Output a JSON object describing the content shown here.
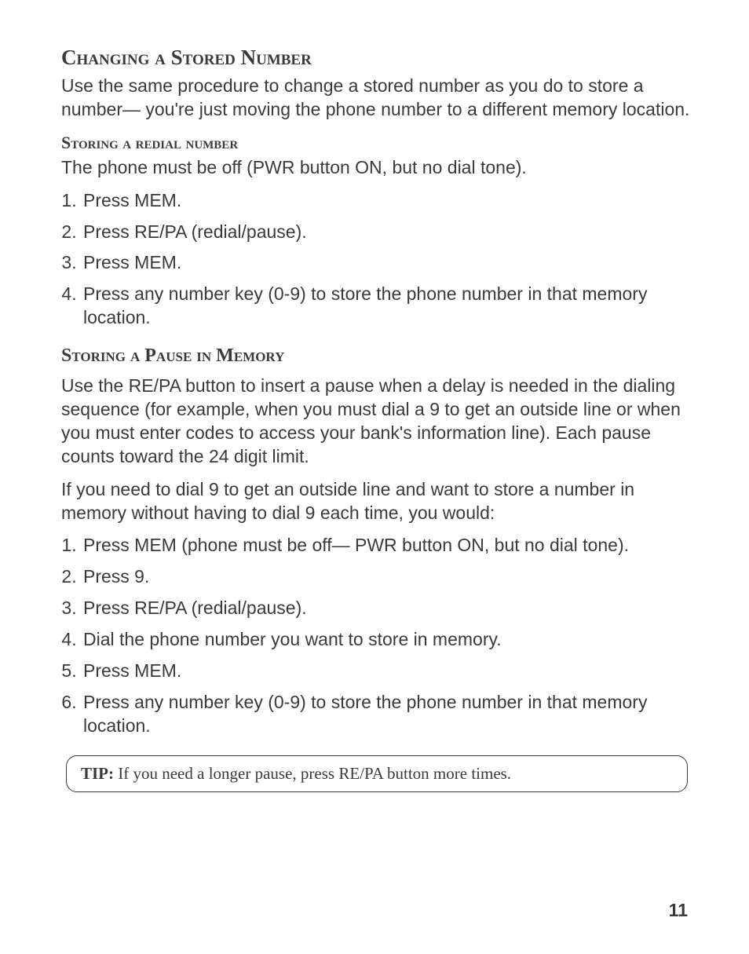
{
  "section1": {
    "heading": "Changing a Stored Number",
    "body": "Use the same procedure to change a stored number as you do to store a number— you're just moving the phone number to a different memory location."
  },
  "section2": {
    "heading": "Storing a redial number",
    "intro": "The phone must be off (PWR button ON, but no dial tone).",
    "steps": [
      "Press MEM.",
      "Press RE/PA (redial/pause).",
      "Press MEM.",
      "Press any number key (0-9) to store the phone number in that memory location."
    ]
  },
  "section3": {
    "heading": "Storing a Pause in Memory",
    "para1": "Use the RE/PA button to insert a pause when a delay is needed in the dialing sequence (for example, when you must dial a 9 to get an outside line or when you must enter codes to access your bank's information line). Each pause counts toward the 24 digit limit.",
    "para2": "If you need to dial 9 to get an outside line and want to store a number in memory without having to dial 9 each time, you would:",
    "steps": [
      "Press MEM (phone must be off— PWR button ON, but no dial tone).",
      "Press 9.",
      "Press RE/PA (redial/pause).",
      "Dial the phone number you want to store in memory.",
      "Press MEM.",
      " Press any number key (0-9) to store the phone number in that memory location."
    ]
  },
  "tip": {
    "label": "TIP:",
    "text": " If you need a longer pause, press RE/PA button more times."
  },
  "page_number": "11"
}
